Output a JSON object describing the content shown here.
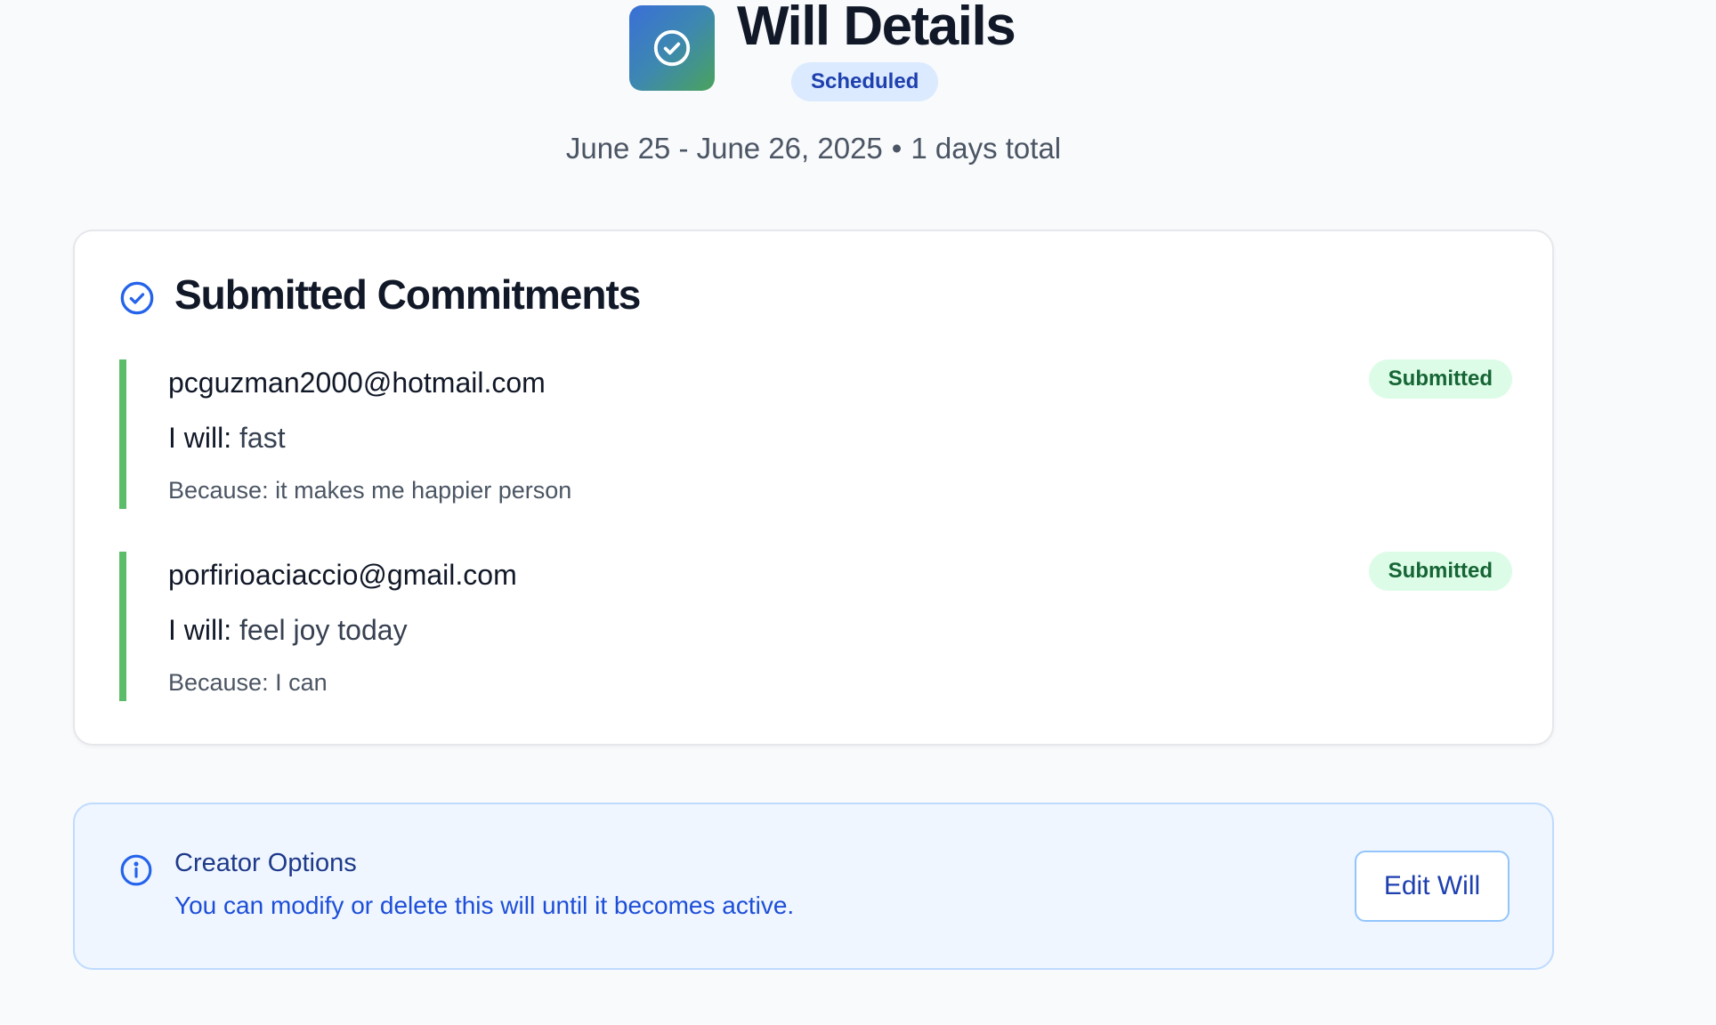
{
  "header": {
    "title": "Will Details",
    "status": "Scheduled",
    "date_range": "June 25 - June 26, 2025",
    "separator": "•",
    "duration": "1 days total"
  },
  "commitments": {
    "title": "Submitted Commitments",
    "will_label": "I will:",
    "because_label": "Because:",
    "items": [
      {
        "email": "pcguzman2000@hotmail.com",
        "will": "fast",
        "because": "it makes me happier person",
        "status": "Submitted"
      },
      {
        "email": "porfirioaciaccio@gmail.com",
        "will": "feel joy today",
        "because": "I can",
        "status": "Submitted"
      }
    ]
  },
  "creator_options": {
    "title": "Creator Options",
    "description": "You can modify or delete this will until it becomes active.",
    "edit_label": "Edit Will"
  },
  "colors": {
    "accent_blue": "#1e40af",
    "submitted_green": "#5bbd6a",
    "info_background": "#eff6ff"
  },
  "icons": {
    "app": "check-circle-icon",
    "commitments": "check-circle-icon",
    "options": "info-circle-icon"
  }
}
